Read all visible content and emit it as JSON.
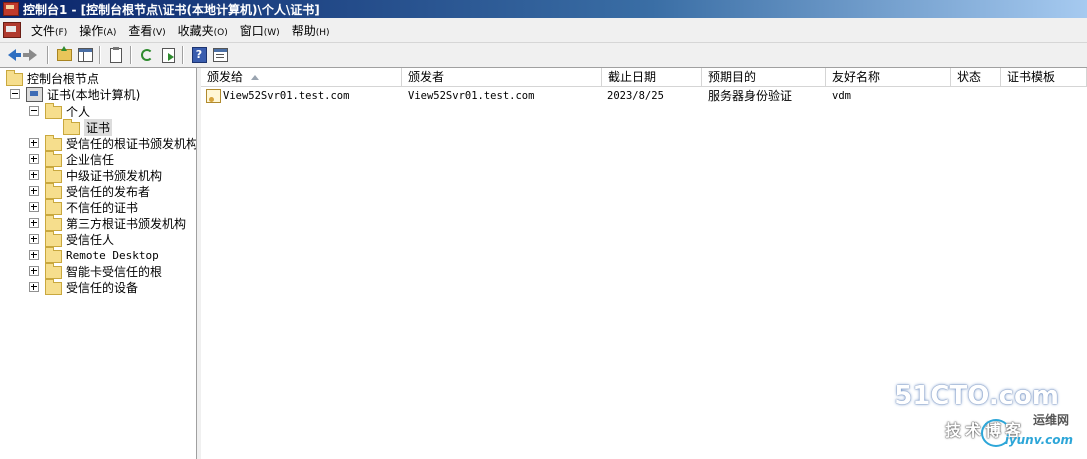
{
  "window": {
    "title": "控制台1 - [控制台根节点\\证书(本地计算机)\\个人\\证书]"
  },
  "menu": [
    {
      "label": "文件",
      "accel": "(F)"
    },
    {
      "label": "操作",
      "accel": "(A)"
    },
    {
      "label": "查看",
      "accel": "(V)"
    },
    {
      "label": "收藏夹",
      "accel": "(O)"
    },
    {
      "label": "窗口",
      "accel": "(W)"
    },
    {
      "label": "帮助",
      "accel": "(H)"
    }
  ],
  "toolbar": {
    "buttons": [
      "back-icon",
      "forward-icon",
      "up-folder-icon",
      "show-tree-icon",
      "clipboard-icon",
      "refresh-icon",
      "export-list-icon",
      "help-icon",
      "properties-icon"
    ]
  },
  "tree": {
    "root": "控制台根节点",
    "store": "证书(本地计算机)",
    "personal": "个人",
    "certificates": "证书",
    "items": [
      "受信任的根证书颁发机构",
      "企业信任",
      "中级证书颁发机构",
      "受信任的发布者",
      "不信任的证书",
      "第三方根证书颁发机构",
      "受信任人",
      "Remote Desktop",
      "智能卡受信任的根",
      "受信任的设备"
    ]
  },
  "list": {
    "columns": [
      "颁发给",
      "颁发者",
      "截止日期",
      "预期目的",
      "友好名称",
      "状态",
      "证书模板"
    ],
    "rows": [
      {
        "issued_to": "View52Svr01.test.com",
        "issued_by": "View52Svr01.test.com",
        "expiration": "2023/8/25",
        "purpose": "服务器身份验证",
        "friendly_name": "vdm",
        "status": "",
        "template": ""
      }
    ]
  },
  "watermark": {
    "brand": "51CTO.com",
    "tagline": "技术博客",
    "yunwei": "运维网",
    "url": "iyunv.com"
  }
}
